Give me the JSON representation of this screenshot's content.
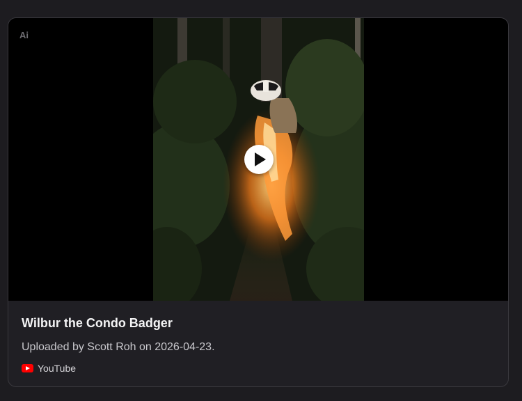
{
  "card": {
    "ai_badge": "Ai",
    "title": "Wilbur the Condo Badger",
    "subtitle": "Uploaded by Scott Roh on 2026-04-23.",
    "source": {
      "label": "YouTube",
      "icon": "youtube-icon",
      "icon_color": "#ff0000"
    }
  },
  "media": {
    "play_icon": "play-icon"
  },
  "colors": {
    "page_background": "#1d1c20",
    "card_background": "#201f24",
    "card_border": "#3a393e",
    "title_text": "#f4f4f5"
  }
}
